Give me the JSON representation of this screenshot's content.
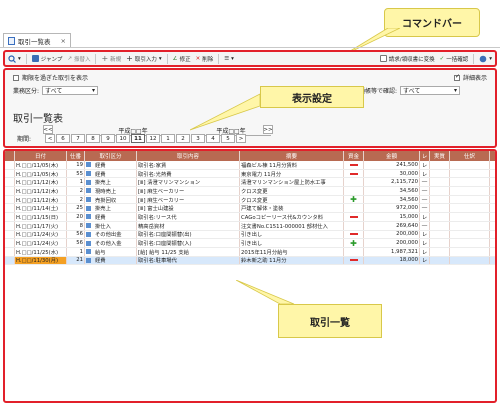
{
  "tab": {
    "title": "取引一覧表",
    "close": "×"
  },
  "toolbar": {
    "items": [
      {
        "label": "",
        "icon": "search-icon"
      },
      {
        "label": "ジャンプ",
        "icon": "jump-icon"
      },
      {
        "label": "振替入",
        "icon": "transfer-icon"
      },
      {
        "label": "新規",
        "icon": "plus-icon"
      },
      {
        "label": "取引入力",
        "icon": "plus-icon"
      },
      {
        "label": "修正",
        "icon": "edit-icon"
      },
      {
        "label": "削除",
        "icon": "delete-icon"
      },
      {
        "label": "",
        "icon": "list-icon"
      }
    ],
    "right": [
      {
        "label": "請求/領収書に変換",
        "icon": "convert-icon"
      },
      {
        "label": "一括確認",
        "icon": "check-icon"
      },
      {
        "label": "",
        "icon": "help-icon"
      }
    ]
  },
  "settings": {
    "overdue_label": "期限を過ぎた取引を表示",
    "detail_label": "詳細表示",
    "category_label": "業務区分:",
    "category_value": "すべて",
    "confirm_label": "通帳等で確認:",
    "confirm_value": "すべて",
    "title": "取引一覧表",
    "period_label": "期間:",
    "era1": "平成□□年",
    "era2": "平成□□年",
    "months": [
      "6",
      "7",
      "8",
      "9",
      "10",
      "11",
      "12",
      "1",
      "2",
      "3",
      "4",
      "5"
    ],
    "active_month": "11",
    "prev": "<",
    "prev2": "<<",
    "next": ">",
    "next2": ">>"
  },
  "callouts": {
    "command": "コマンドバー",
    "settings": "表示設定",
    "list": "取引一覧"
  },
  "columns": [
    "日付",
    "仕番",
    "取引区分",
    "取引内容",
    "摘要",
    "資金",
    "金額",
    "レ",
    "実質",
    "仕訳"
  ],
  "rows": [
    {
      "date": "H.□□/11/05(木)",
      "no": "19",
      "kind": "経費",
      "content": "取引名:家賃",
      "memo": "福森ビル棟 11月分賃料",
      "fund": "minus",
      "amount": "241,500",
      "flag": "レ"
    },
    {
      "date": "H.□□/11/05(木)",
      "no": "55",
      "kind": "経費",
      "content": "取引名:光熱費",
      "memo": "東京電力 11月分",
      "fund": "minus",
      "amount": "30,000",
      "flag": "レ"
    },
    {
      "date": "H.□□/11/12(木)",
      "no": "1",
      "kind": "掛売上",
      "content": "[ⅲ] 清澄マリンマンション",
      "memo": "清澄マリンマンション屋上防水工事",
      "fund": "",
      "amount": "2,115,720",
      "flag": "―"
    },
    {
      "date": "H.□□/11/12(木)",
      "no": "2",
      "kind": "現時売上",
      "content": "[ⅲ] 麻生ベーカリー",
      "memo": "クロス変更",
      "fund": "",
      "amount": "34,560",
      "flag": "―"
    },
    {
      "date": "H.□□/11/12(木)",
      "no": "2",
      "kind": "売掛回収",
      "content": "[ⅲ] 麻生ベーカリー",
      "memo": "クロス変更",
      "fund": "plus",
      "amount": "34,560",
      "flag": "―"
    },
    {
      "date": "H.□□/11/14(土)",
      "no": "25",
      "kind": "掛売上",
      "content": "[ⅲ] 富士山建設",
      "memo": "戸建て解体・塗装",
      "fund": "",
      "amount": "972,000",
      "flag": "―"
    },
    {
      "date": "H.□□/11/15(日)",
      "no": "20",
      "kind": "経費",
      "content": "取引名:リース代",
      "memo": "CAGoコピーリース代&カウンタ料",
      "fund": "minus",
      "amount": "15,000",
      "flag": "レ"
    },
    {
      "date": "H.□□/11/17(火)",
      "no": "8",
      "kind": "掛仕入",
      "content": "精高岳資材",
      "memo": "注文書No.C1511-000001 部材仕入",
      "fund": "",
      "amount": "269,640",
      "flag": "―"
    },
    {
      "date": "H.□□/11/24(火)",
      "no": "56",
      "kind": "その他出金",
      "content": "取引名:口座間振替(出)",
      "memo": "引き出し",
      "fund": "minus",
      "amount": "200,000",
      "flag": "レ"
    },
    {
      "date": "H.□□/11/24(火)",
      "no": "56",
      "kind": "その他入金",
      "content": "取引名:口座間振替(入)",
      "memo": "引き出し",
      "fund": "plus",
      "amount": "200,000",
      "flag": "レ"
    },
    {
      "date": "H.□□/11/25(水)",
      "no": "1",
      "kind": "給与",
      "content": "[給] 給与 11/25 支給",
      "memo": "2015年11月分給与",
      "fund": "",
      "amount": "1,987,321",
      "flag": "レ"
    },
    {
      "date": "H.□□/11/30(月)",
      "no": "21",
      "kind": "経費",
      "content": "取引名:駐車場代",
      "memo": "鈴木新之助 11月分",
      "fund": "minus",
      "amount": "18,000",
      "flag": "レ"
    }
  ]
}
